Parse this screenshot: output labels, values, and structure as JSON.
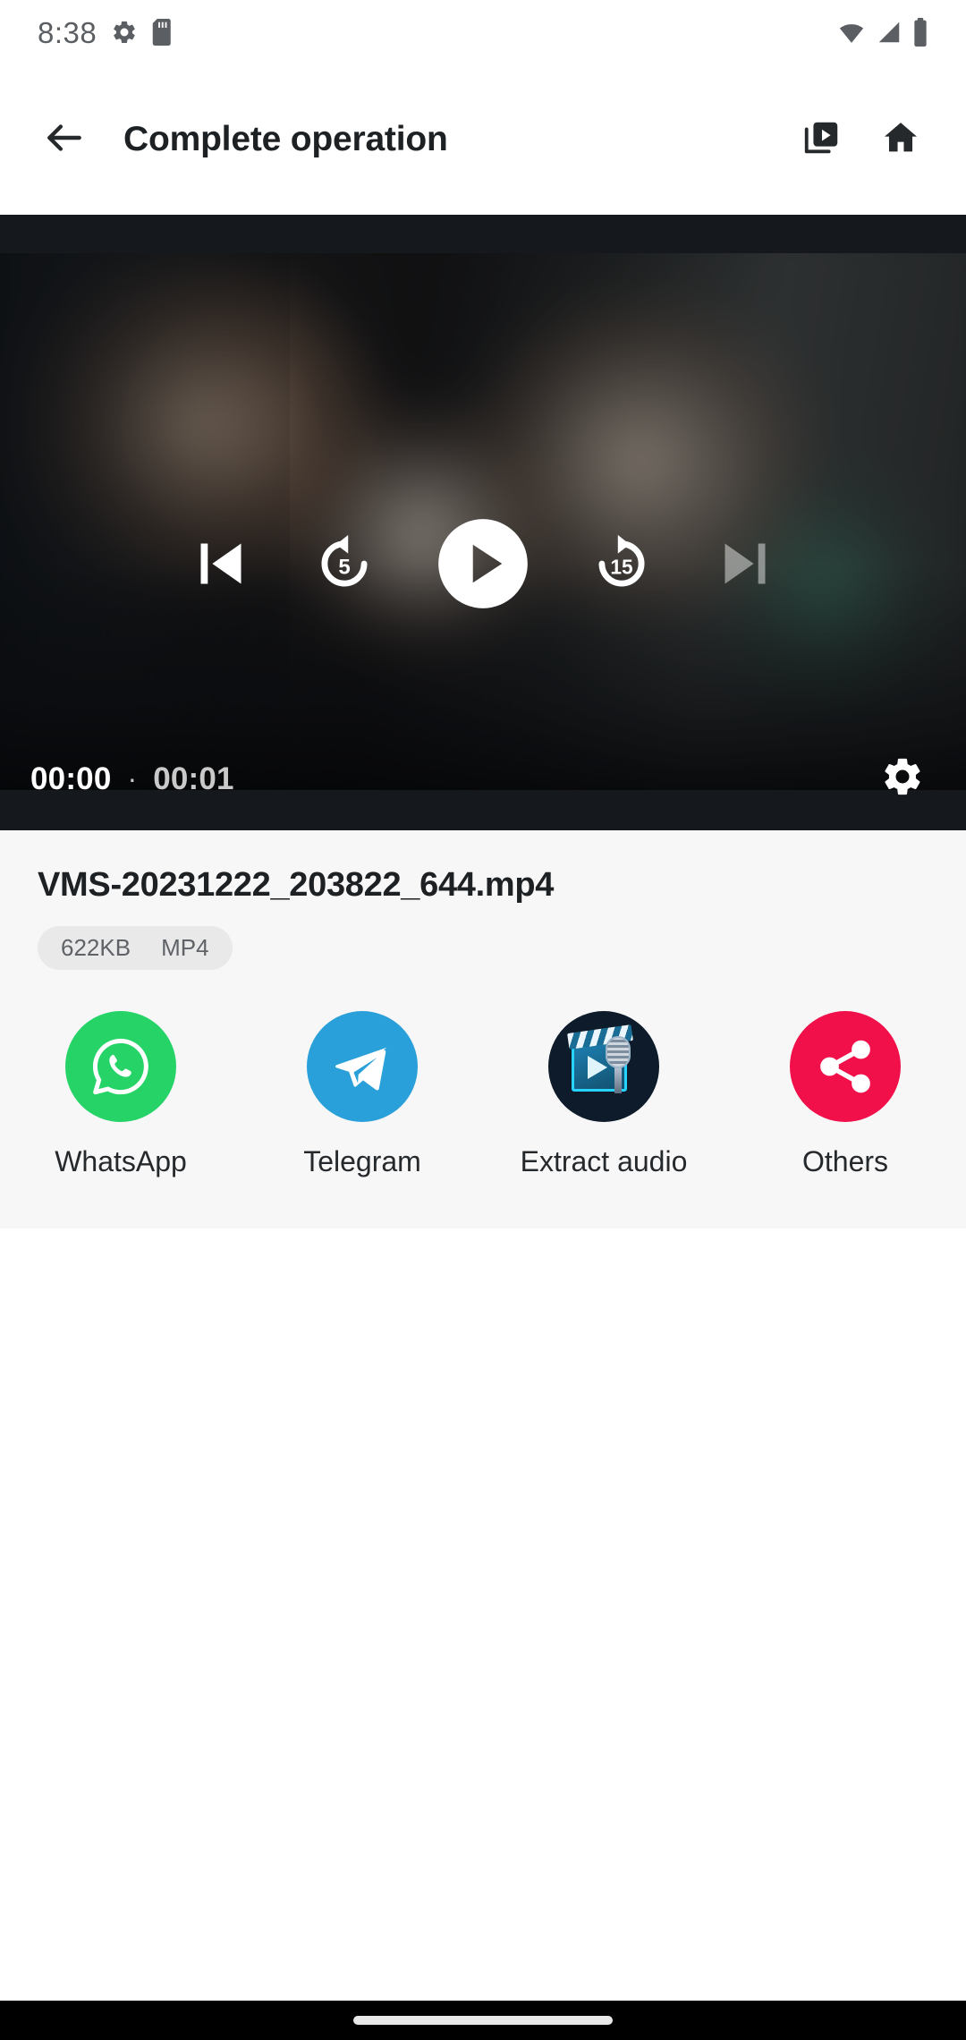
{
  "status_bar": {
    "time": "8:38",
    "left_icons": [
      "gear-icon",
      "sd-card-icon"
    ],
    "right_icons": [
      "wifi-icon",
      "cellular-signal-icon",
      "battery-icon"
    ]
  },
  "app_bar": {
    "back_icon": "arrow-back-icon",
    "title": "Complete operation",
    "actions": [
      {
        "icon": "video-library-icon",
        "name": "video-library-button"
      },
      {
        "icon": "home-icon",
        "name": "home-button"
      }
    ]
  },
  "player": {
    "controls": [
      {
        "name": "previous-button",
        "icon": "skip-previous-icon",
        "label": "",
        "disabled": false
      },
      {
        "name": "rewind-button",
        "icon": "replay-5-icon",
        "label": "5",
        "disabled": false
      },
      {
        "name": "play-button",
        "icon": "play-icon",
        "label": "",
        "disabled": false
      },
      {
        "name": "forward-button",
        "icon": "forward-15-icon",
        "label": "15",
        "disabled": false
      },
      {
        "name": "next-button",
        "icon": "skip-next-icon",
        "label": "",
        "disabled": true
      }
    ],
    "seek": {
      "progress_percent": 0
    },
    "time_current": "00:00",
    "time_separator": "·",
    "time_total": "00:01",
    "settings_icon": "settings-gear-icon"
  },
  "file": {
    "name": "VMS-20231222_203822_644.mp4",
    "size": "622KB",
    "format": "MP4"
  },
  "share_targets": [
    {
      "label": "WhatsApp",
      "icon": "whatsapp-icon",
      "color": "#25D366",
      "name": "share-target-whatsapp"
    },
    {
      "label": "Telegram",
      "icon": "telegram-icon",
      "color": "#2AA0DA",
      "name": "share-target-telegram"
    },
    {
      "label": "Extract audio",
      "icon": "extract-audio-icon",
      "color": "#0d1b2a",
      "name": "share-target-extract-audio"
    },
    {
      "label": "Others",
      "icon": "share-icon",
      "color": "#F1104A",
      "name": "share-target-others"
    }
  ],
  "nav_bar": {
    "gesture_pill": "home-gesture-pill"
  },
  "colors": {
    "accent_whatsapp": "#25D366",
    "accent_telegram": "#2AA0DA",
    "accent_others": "#F1104A",
    "card_background": "#f7f7f8",
    "text_primary": "#1e2124"
  }
}
